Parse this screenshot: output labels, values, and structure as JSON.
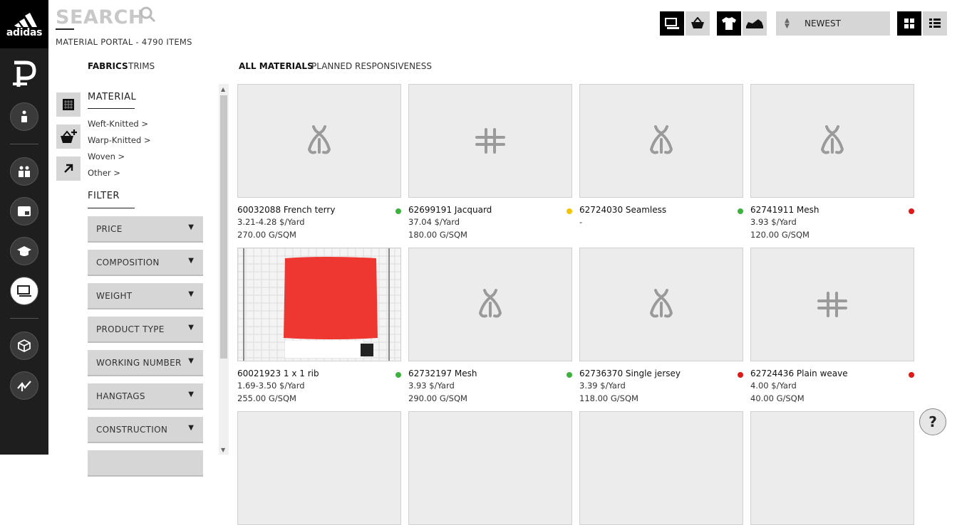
{
  "brand": {
    "name": "adidas"
  },
  "header": {
    "search_label": "SEARCH",
    "portal_info": "MATERIAL PORTAL - 4790 ITEMS"
  },
  "toolbar": {
    "sort_label": "NEWEST"
  },
  "categories": {
    "fabrics": "FABRICS",
    "trims": "TRIMS"
  },
  "views": {
    "all_materials": "ALL MATERIALS",
    "planned": "PLANNED RESPONSIVENESS"
  },
  "material": {
    "title": "MATERIAL",
    "items": [
      "Weft-Knitted >",
      "Warp-Knitted >",
      "Woven >",
      "Other >"
    ]
  },
  "filter": {
    "title": "FILTER",
    "items": [
      "PRICE",
      "COMPOSITION",
      "WEIGHT",
      "PRODUCT TYPE",
      "WORKING NUMBER",
      "HANGTAGS",
      "CONSTRUCTION"
    ]
  },
  "products": [
    {
      "title": "60032088 French terry",
      "price": "3.21-4.28 $/Yard",
      "weight": "270.00 G/SQM",
      "status": "#3cb33c",
      "icon": "knit-placeholder-icon"
    },
    {
      "title": "62699191 Jacquard",
      "price": "37.04 $/Yard",
      "weight": "180.00 G/SQM",
      "status": "#f5c400",
      "icon": "trim-placeholder-icon"
    },
    {
      "title": "62724030 Seamless",
      "price": "-",
      "weight": "",
      "status": "#3cb33c",
      "icon": "knit-placeholder-icon"
    },
    {
      "title": "62741911 Mesh",
      "price": "3.93 $/Yard",
      "weight": "120.00 G/SQM",
      "status": "#e01818",
      "icon": "knit-placeholder-icon"
    },
    {
      "title": "60021923 1 x 1 rib",
      "price": "1.69-3.50 $/Yard",
      "weight": "255.00 G/SQM",
      "status": "#3cb33c",
      "icon": "red-fabric-swatch-image"
    },
    {
      "title": "62732197 Mesh",
      "price": "3.93 $/Yard",
      "weight": "290.00 G/SQM",
      "status": "#3cb33c",
      "icon": "knit-placeholder-icon"
    },
    {
      "title": "62736370 Single jersey",
      "price": "3.39 $/Yard",
      "weight": "118.00 G/SQM",
      "status": "#e01818",
      "icon": "knit-placeholder-icon"
    },
    {
      "title": "62724436 Plain weave",
      "price": "4.00 $/Yard",
      "weight": "40.00 G/SQM",
      "status": "#e01818",
      "icon": "trim-placeholder-icon"
    }
  ],
  "help": {
    "label": "?"
  }
}
